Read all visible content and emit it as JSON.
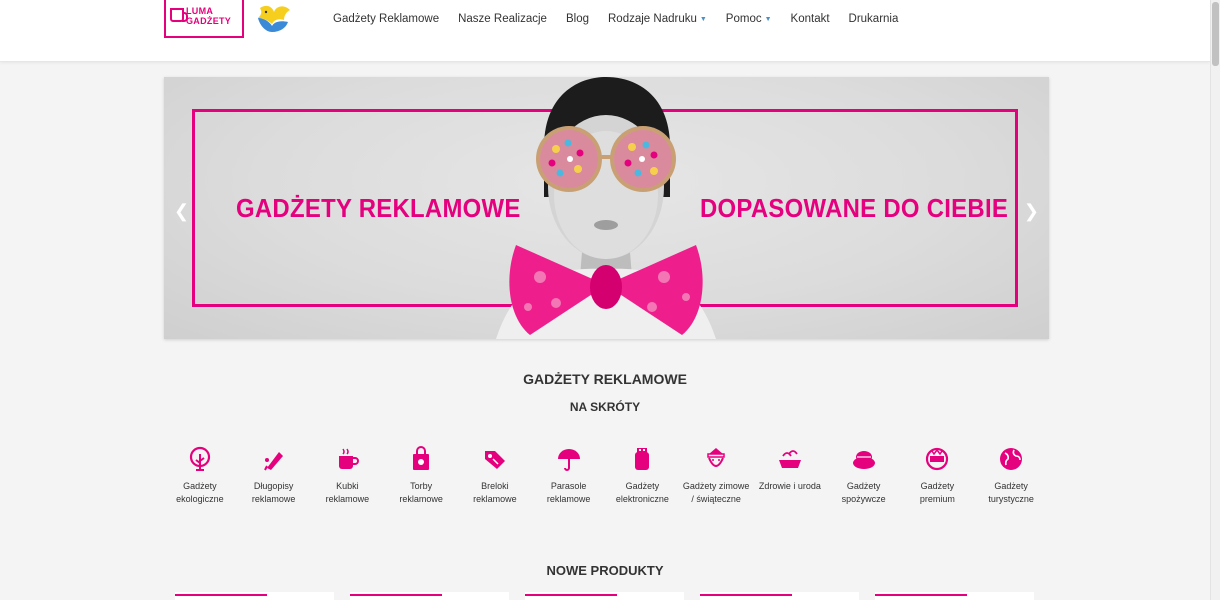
{
  "brand": {
    "logo_line1": "LUMA",
    "logo_line2": "GADŻETY",
    "accent": "#e5007e"
  },
  "nav": [
    {
      "label": "Gadżety Reklamowe",
      "dropdown": false
    },
    {
      "label": "Nasze Realizacje",
      "dropdown": false
    },
    {
      "label": "Blog",
      "dropdown": false
    },
    {
      "label": "Rodzaje Nadruku",
      "dropdown": true
    },
    {
      "label": "Pomoc",
      "dropdown": true
    },
    {
      "label": "Kontakt",
      "dropdown": false
    },
    {
      "label": "Drukarnia",
      "dropdown": false
    }
  ],
  "slider": {
    "left_text": "GADŻETY REKLAMOWE",
    "right_text": "DOPASOWANE DO CIEBIE",
    "prev_icon": "chevron-left-icon",
    "next_icon": "chevron-right-icon"
  },
  "sections": {
    "title": "GADŻETY REKLAMOWE",
    "subtitle": "NA SKRÓTY",
    "new_products": "NOWE PRODUKTY"
  },
  "categories": [
    {
      "label": "Gadżety ekologiczne",
      "icon": "tree-icon"
    },
    {
      "label": "Długopisy reklamowe",
      "icon": "pen-icon"
    },
    {
      "label": "Kubki reklamowe",
      "icon": "mug-icon"
    },
    {
      "label": "Torby reklamowe",
      "icon": "bag-icon"
    },
    {
      "label": "Breloki reklamowe",
      "icon": "tag-icon"
    },
    {
      "label": "Parasole reklamowe",
      "icon": "umbrella-icon"
    },
    {
      "label": "Gadżety elektroniczne",
      "icon": "usb-icon"
    },
    {
      "label": "Gadżety zimowe / świąteczne",
      "icon": "santa-icon"
    },
    {
      "label": "Zdrowie i uroda",
      "icon": "spa-icon"
    },
    {
      "label": "Gadżety spożywcze",
      "icon": "food-icon"
    },
    {
      "label": "Gadżety premium",
      "icon": "premium-icon"
    },
    {
      "label": "Gadżety turystyczne",
      "icon": "globe-icon"
    }
  ]
}
